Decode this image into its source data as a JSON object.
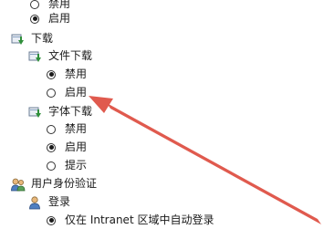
{
  "tree": {
    "rows": [
      {
        "kind": "radio",
        "label": "禁用",
        "checked": false,
        "icon": "radio-button"
      },
      {
        "kind": "radio",
        "label": "启用",
        "checked": true,
        "icon": "radio-button"
      },
      {
        "kind": "group",
        "label": "下载",
        "icon": "download-settings-icon"
      },
      {
        "kind": "group",
        "label": "文件下载",
        "icon": "download-settings-icon"
      },
      {
        "kind": "radio",
        "label": "禁用",
        "checked": true,
        "icon": "radio-button"
      },
      {
        "kind": "radio",
        "label": "启用",
        "checked": false,
        "icon": "radio-button"
      },
      {
        "kind": "group",
        "label": "字体下载",
        "icon": "download-settings-icon"
      },
      {
        "kind": "radio",
        "label": "禁用",
        "checked": false,
        "icon": "radio-button"
      },
      {
        "kind": "radio",
        "label": "启用",
        "checked": true,
        "icon": "radio-button"
      },
      {
        "kind": "radio",
        "label": "提示",
        "checked": false,
        "icon": "radio-button"
      },
      {
        "kind": "group",
        "label": "用户身份验证",
        "icon": "users-icon"
      },
      {
        "kind": "group",
        "label": "登录",
        "icon": "user-login-icon"
      },
      {
        "kind": "radio",
        "label": "仅在 Intranet 区域中自动登录",
        "checked": true,
        "icon": "radio-button"
      }
    ]
  },
  "annotation": {
    "arrow_color": "#e05a4e"
  }
}
